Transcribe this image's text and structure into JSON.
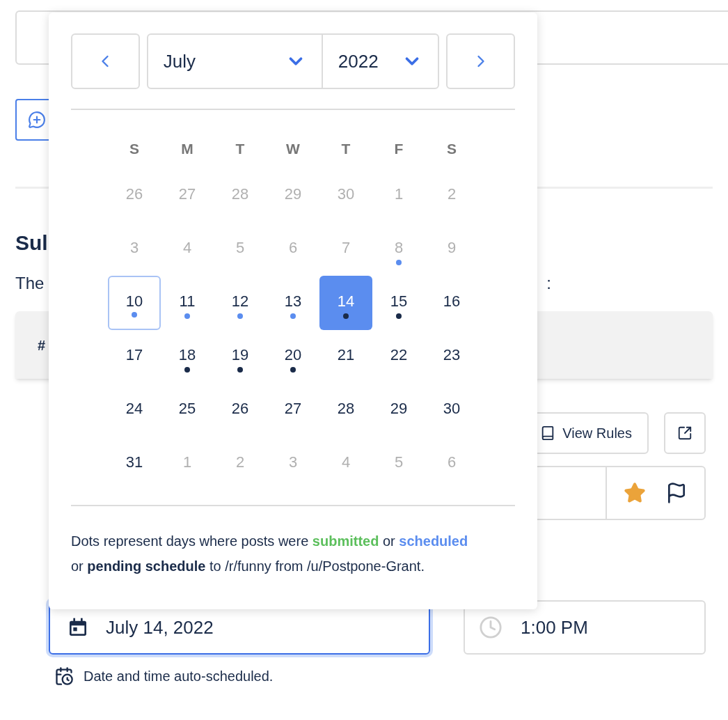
{
  "page": {
    "heading": "Sul",
    "intro": "The",
    "intro_end": ":",
    "table_header": "#",
    "view_rules": "View Rules"
  },
  "datepicker": {
    "month": "July",
    "year": "2022",
    "weekdays": [
      "S",
      "M",
      "T",
      "W",
      "T",
      "F",
      "S"
    ],
    "weeks": [
      [
        {
          "day": "26",
          "muted": true
        },
        {
          "day": "27",
          "muted": true
        },
        {
          "day": "28",
          "muted": true
        },
        {
          "day": "29",
          "muted": true
        },
        {
          "day": "30",
          "muted": true
        },
        {
          "day": "1",
          "muted": true
        },
        {
          "day": "2",
          "muted": true
        }
      ],
      [
        {
          "day": "3",
          "muted": true
        },
        {
          "day": "4",
          "muted": true
        },
        {
          "day": "5",
          "muted": true
        },
        {
          "day": "6",
          "muted": true
        },
        {
          "day": "7",
          "muted": true
        },
        {
          "day": "8",
          "muted": true,
          "color": "#5b8def"
        },
        {
          "day": "9",
          "muted": true
        }
      ],
      [
        {
          "day": "10",
          "muted": false,
          "today": true,
          "color": "#5b8def"
        },
        {
          "day": "11",
          "muted": false,
          "color": "#5b8def"
        },
        {
          "day": "12",
          "muted": false,
          "color": "#5b8def"
        },
        {
          "day": "13",
          "muted": false,
          "color": "#5b8def"
        },
        {
          "day": "14",
          "selected": true,
          "color": "#1a2b49"
        },
        {
          "day": "15",
          "muted": false,
          "color": "#1a2b49"
        },
        {
          "day": "16",
          "muted": false
        }
      ],
      [
        {
          "day": "17",
          "muted": false
        },
        {
          "day": "18",
          "muted": false,
          "color": "#1a2b49"
        },
        {
          "day": "19",
          "muted": false,
          "color": "#1a2b49"
        },
        {
          "day": "20",
          "muted": false,
          "color": "#1a2b49"
        },
        {
          "day": "21",
          "muted": false
        },
        {
          "day": "22",
          "muted": false
        },
        {
          "day": "23",
          "muted": false
        }
      ],
      [
        {
          "day": "24",
          "muted": false
        },
        {
          "day": "25",
          "muted": false
        },
        {
          "day": "26",
          "muted": false
        },
        {
          "day": "27",
          "muted": false
        },
        {
          "day": "28",
          "muted": false
        },
        {
          "day": "29",
          "muted": false
        },
        {
          "day": "30",
          "muted": false
        }
      ],
      [
        {
          "day": "31",
          "muted": false
        },
        {
          "day": "1",
          "muted": true
        },
        {
          "day": "2",
          "muted": true
        },
        {
          "day": "3",
          "muted": true
        },
        {
          "day": "4",
          "muted": true
        },
        {
          "day": "5",
          "muted": true
        },
        {
          "day": "6",
          "muted": true
        }
      ]
    ],
    "legend": [
      {
        "kind": "plain",
        "text": "Dots represent days where posts were "
      },
      {
        "kind": "submitted",
        "text": "submitted"
      },
      {
        "kind": "plain",
        "text": " or "
      },
      {
        "kind": "scheduled",
        "text": "scheduled"
      },
      {
        "kind": "plain",
        "text": " or "
      },
      {
        "kind": "pending",
        "text": "pending schedule"
      },
      {
        "kind": "plain",
        "text": " to /r/funny from /u/Postpone-Grant."
      }
    ]
  },
  "date_field": {
    "value": "July 14, 2022"
  },
  "time_field": {
    "value": "1:00 PM"
  },
  "note": "Date and time auto-scheduled."
}
